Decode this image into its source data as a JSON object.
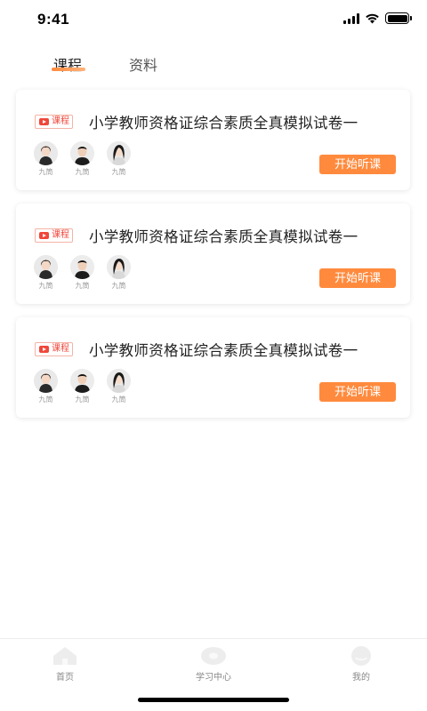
{
  "status_bar": {
    "time": "9:41",
    "signal_icon": "cellular-signal-icon",
    "wifi_icon": "wifi-icon",
    "battery_icon": "battery-icon"
  },
  "tabs": [
    {
      "label": "课程",
      "active": true
    },
    {
      "label": "资料",
      "active": false
    }
  ],
  "accent_color": "#ff8a3d",
  "tag_color": "#f0473a",
  "courses": [
    {
      "tag": "课程",
      "title": "小学教师资格证综合素质全真模拟试卷一",
      "teachers": [
        "九筒",
        "九筒",
        "九筒"
      ],
      "button": "开始听课"
    },
    {
      "tag": "课程",
      "title": "小学教师资格证综合素质全真模拟试卷一",
      "teachers": [
        "九筒",
        "九筒",
        "九筒"
      ],
      "button": "开始听课"
    },
    {
      "tag": "课程",
      "title": "小学教师资格证综合素质全真模拟试卷一",
      "teachers": [
        "九筒",
        "九筒",
        "九筒"
      ],
      "button": "开始听课"
    }
  ],
  "bottom_nav": [
    {
      "label": "首页",
      "icon": "home-icon"
    },
    {
      "label": "学习中心",
      "icon": "study-center-icon"
    },
    {
      "label": "我的",
      "icon": "profile-icon"
    }
  ]
}
